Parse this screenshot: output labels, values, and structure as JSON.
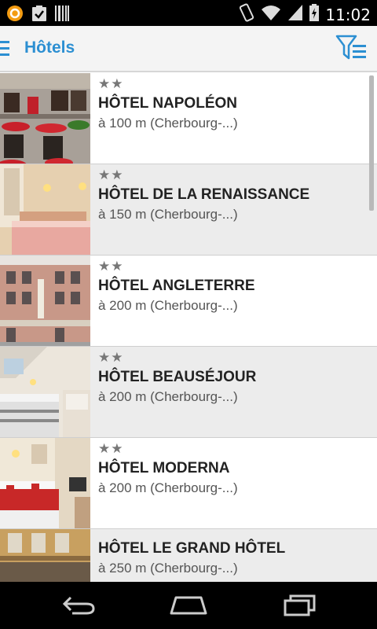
{
  "status_bar": {
    "time": "11:02"
  },
  "action_bar": {
    "title": "Hôtels"
  },
  "hotels": [
    {
      "stars": "★★",
      "name": "HÔTEL NAPOLÉON",
      "distance": "à 100 m (Cherbourg-...)"
    },
    {
      "stars": "★★",
      "name": "HÔTEL DE LA RENAISSANCE",
      "distance": "à 150 m (Cherbourg-...)"
    },
    {
      "stars": "★★",
      "name": "HÔTEL ANGLETERRE",
      "distance": "à 200 m (Cherbourg-...)"
    },
    {
      "stars": "★★",
      "name": "HÔTEL BEAUSÉJOUR",
      "distance": "à 200 m (Cherbourg-...)"
    },
    {
      "stars": "★★",
      "name": "HÔTEL MODERNA",
      "distance": "à 200 m (Cherbourg-...)"
    },
    {
      "stars": "",
      "name": "HÔTEL LE GRAND HÔTEL",
      "distance": "à 250 m (Cherbourg-...)"
    }
  ],
  "colors": {
    "accent": "#2c8fd2",
    "list_alt_bg": "#ececec"
  },
  "icons": {
    "status_left": [
      "app-notification-icon",
      "clipboard-check-icon",
      "barcode-icon"
    ],
    "status_right": [
      "vibrate-icon",
      "wifi-icon",
      "signal-icon",
      "battery-icon"
    ],
    "action": [
      "menu-icon",
      "filter-list-icon"
    ],
    "nav": [
      "back-icon",
      "home-icon",
      "recent-apps-icon"
    ]
  }
}
